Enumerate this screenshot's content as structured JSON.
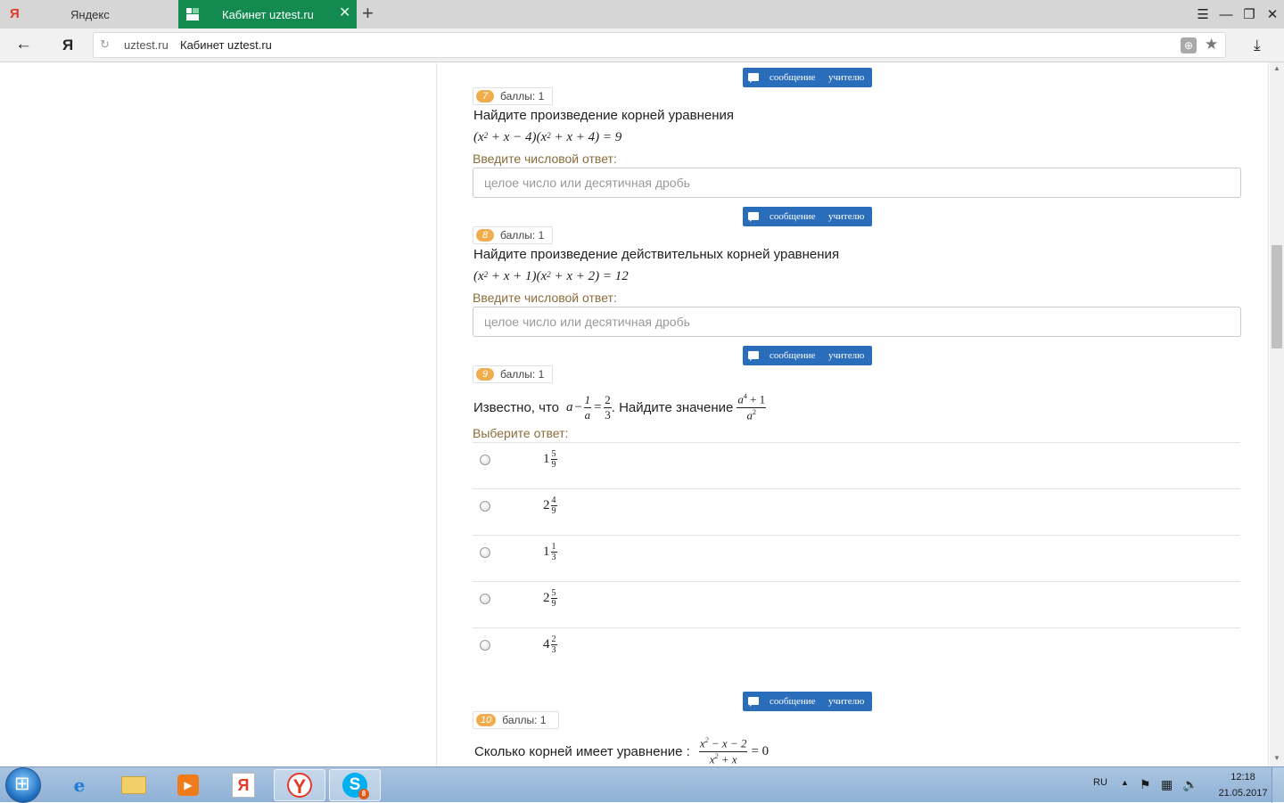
{
  "browser": {
    "tabs": [
      {
        "title": "Яндекс",
        "favicon": "Я"
      },
      {
        "title": "Кабинет uztest.ru"
      }
    ],
    "address": {
      "domain": "uztest.ru",
      "page_title": "Кабинет uztest.ru"
    }
  },
  "message_button": {
    "label_part1": "сообщение",
    "label_part2": "учителю"
  },
  "questions": [
    {
      "number": "7",
      "points": "баллы: 1",
      "text": "Найдите произведение корней уравнения",
      "formula": {
        "a": "(x",
        "b": " + x − 4)(x",
        "c": " + x + 4) = 9",
        "exp": "2"
      },
      "prompt": "Введите числовой ответ:",
      "placeholder": "целое число или десятичная дробь"
    },
    {
      "number": "8",
      "points": "баллы: 1",
      "text": "Найдите произведение действительных корней уравнения",
      "formula": {
        "a": "(x",
        "b": " + x + 1)(x",
        "c": " + x + 2) = 12",
        "exp": "2"
      },
      "prompt": "Введите числовой ответ:",
      "placeholder": "целое число или десятичная дробь"
    },
    {
      "number": "9",
      "points": "баллы: 1",
      "text_before": "Известно, что",
      "given": {
        "var": "a",
        "minus": "−",
        "frac_num": "1",
        "frac_den": "a",
        "eq": "=",
        "val_num": "2",
        "val_den": "3"
      },
      "text_after": ". Найдите значение",
      "target": {
        "num_base": "a",
        "num_exp": "4",
        "num_rest": " + 1",
        "den_base": "a",
        "den_exp": "2"
      },
      "prompt": "Выберите ответ:",
      "options": [
        {
          "whole": "1",
          "num": "5",
          "den": "9"
        },
        {
          "whole": "2",
          "num": "4",
          "den": "9"
        },
        {
          "whole": "1",
          "num": "1",
          "den": "3"
        },
        {
          "whole": "2",
          "num": "5",
          "den": "9"
        },
        {
          "whole": "4",
          "num": "2",
          "den": "3"
        }
      ]
    },
    {
      "number": "10",
      "points": "баллы: 1",
      "text": "Сколько корней имеет уравнение :",
      "num": {
        "a": "x",
        "exp": "2",
        "rest": " − x − 2"
      },
      "den": {
        "a": "x",
        "exp": "2",
        "rest": " + x"
      },
      "rhs": "= 0"
    }
  ],
  "taskbar": {
    "skype_badge": "8"
  },
  "tray": {
    "lang": "RU",
    "time": "12:18",
    "date": "21.05.2017"
  },
  "colors": {
    "tab_active": "#138a4f",
    "message_button": "#2a6ebb",
    "badge": "#f0ad4e",
    "prompt": "#8a6d3b"
  }
}
